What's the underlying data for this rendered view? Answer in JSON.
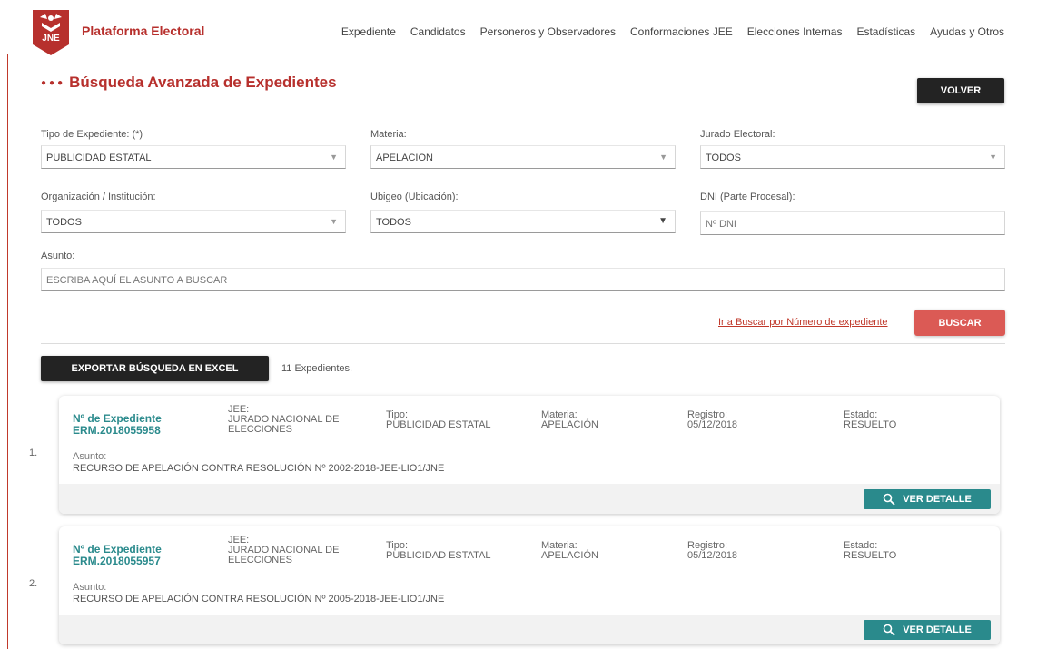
{
  "header": {
    "brand": "Plataforma Electoral",
    "logo_text": "JNE",
    "nav": [
      "Expediente",
      "Candidatos",
      "Personeros y Observadores",
      "Conformaciones JEE",
      "Elecciones Internas",
      "Estadísticas",
      "Ayudas y Otros"
    ]
  },
  "page": {
    "title": "Búsqueda Avanzada de Expedientes",
    "back_label": "VOLVER"
  },
  "form": {
    "tipo": {
      "label": "Tipo de Expediente: (*)",
      "value": "PUBLICIDAD ESTATAL"
    },
    "materia": {
      "label": "Materia:",
      "value": "APELACION"
    },
    "jurado": {
      "label": "Jurado Electoral:",
      "value": "TODOS"
    },
    "organizacion": {
      "label": "Organización / Institución:",
      "value": "TODOS"
    },
    "ubigeo": {
      "label": "Ubigeo (Ubicación):",
      "value": "TODOS"
    },
    "dni": {
      "label": "DNI (Parte Procesal):",
      "placeholder": "Nº DNI"
    },
    "asunto": {
      "label": "Asunto:",
      "placeholder": "ESCRIBA AQUÍ EL ASUNTO A BUSCAR"
    },
    "link_numero": "Ir a Buscar por Número de expediente",
    "search_label": "BUSCAR"
  },
  "results": {
    "export_label": "EXPORTAR BÚSQUEDA EN EXCEL",
    "count_text": "11 Expedientes.",
    "field_labels": {
      "exp": "Nº de Expediente",
      "jee": "JEE:",
      "tipo": "Tipo:",
      "materia": "Materia:",
      "registro": "Registro:",
      "estado": "Estado:",
      "asunto": "Asunto:"
    },
    "detail_label": "VER DETALLE",
    "items": [
      {
        "index": "1.",
        "numero": "ERM.2018055958",
        "jee_line1": "JURADO NACIONAL DE",
        "jee_line2": "ELECCIONES",
        "tipo": "PUBLICIDAD ESTATAL",
        "materia": "APELACIÓN",
        "registro": "05/12/2018",
        "estado": "RESUELTO",
        "asunto": "RECURSO DE APELACIÓN CONTRA RESOLUCIÓN Nº 2002-2018-JEE-LIO1/JNE"
      },
      {
        "index": "2.",
        "numero": "ERM.2018055957",
        "jee_line1": "JURADO NACIONAL DE",
        "jee_line2": "ELECCIONES",
        "tipo": "PUBLICIDAD ESTATAL",
        "materia": "APELACIÓN",
        "registro": "05/12/2018",
        "estado": "RESUELTO",
        "asunto": "RECURSO DE APELACIÓN CONTRA RESOLUCIÓN Nº 2005-2018-JEE-LIO1/JNE"
      }
    ]
  },
  "colors": {
    "brand_red": "#b7302d",
    "search_red": "#db5a55",
    "teal": "#2a8a8c",
    "dark_button": "#232323"
  }
}
